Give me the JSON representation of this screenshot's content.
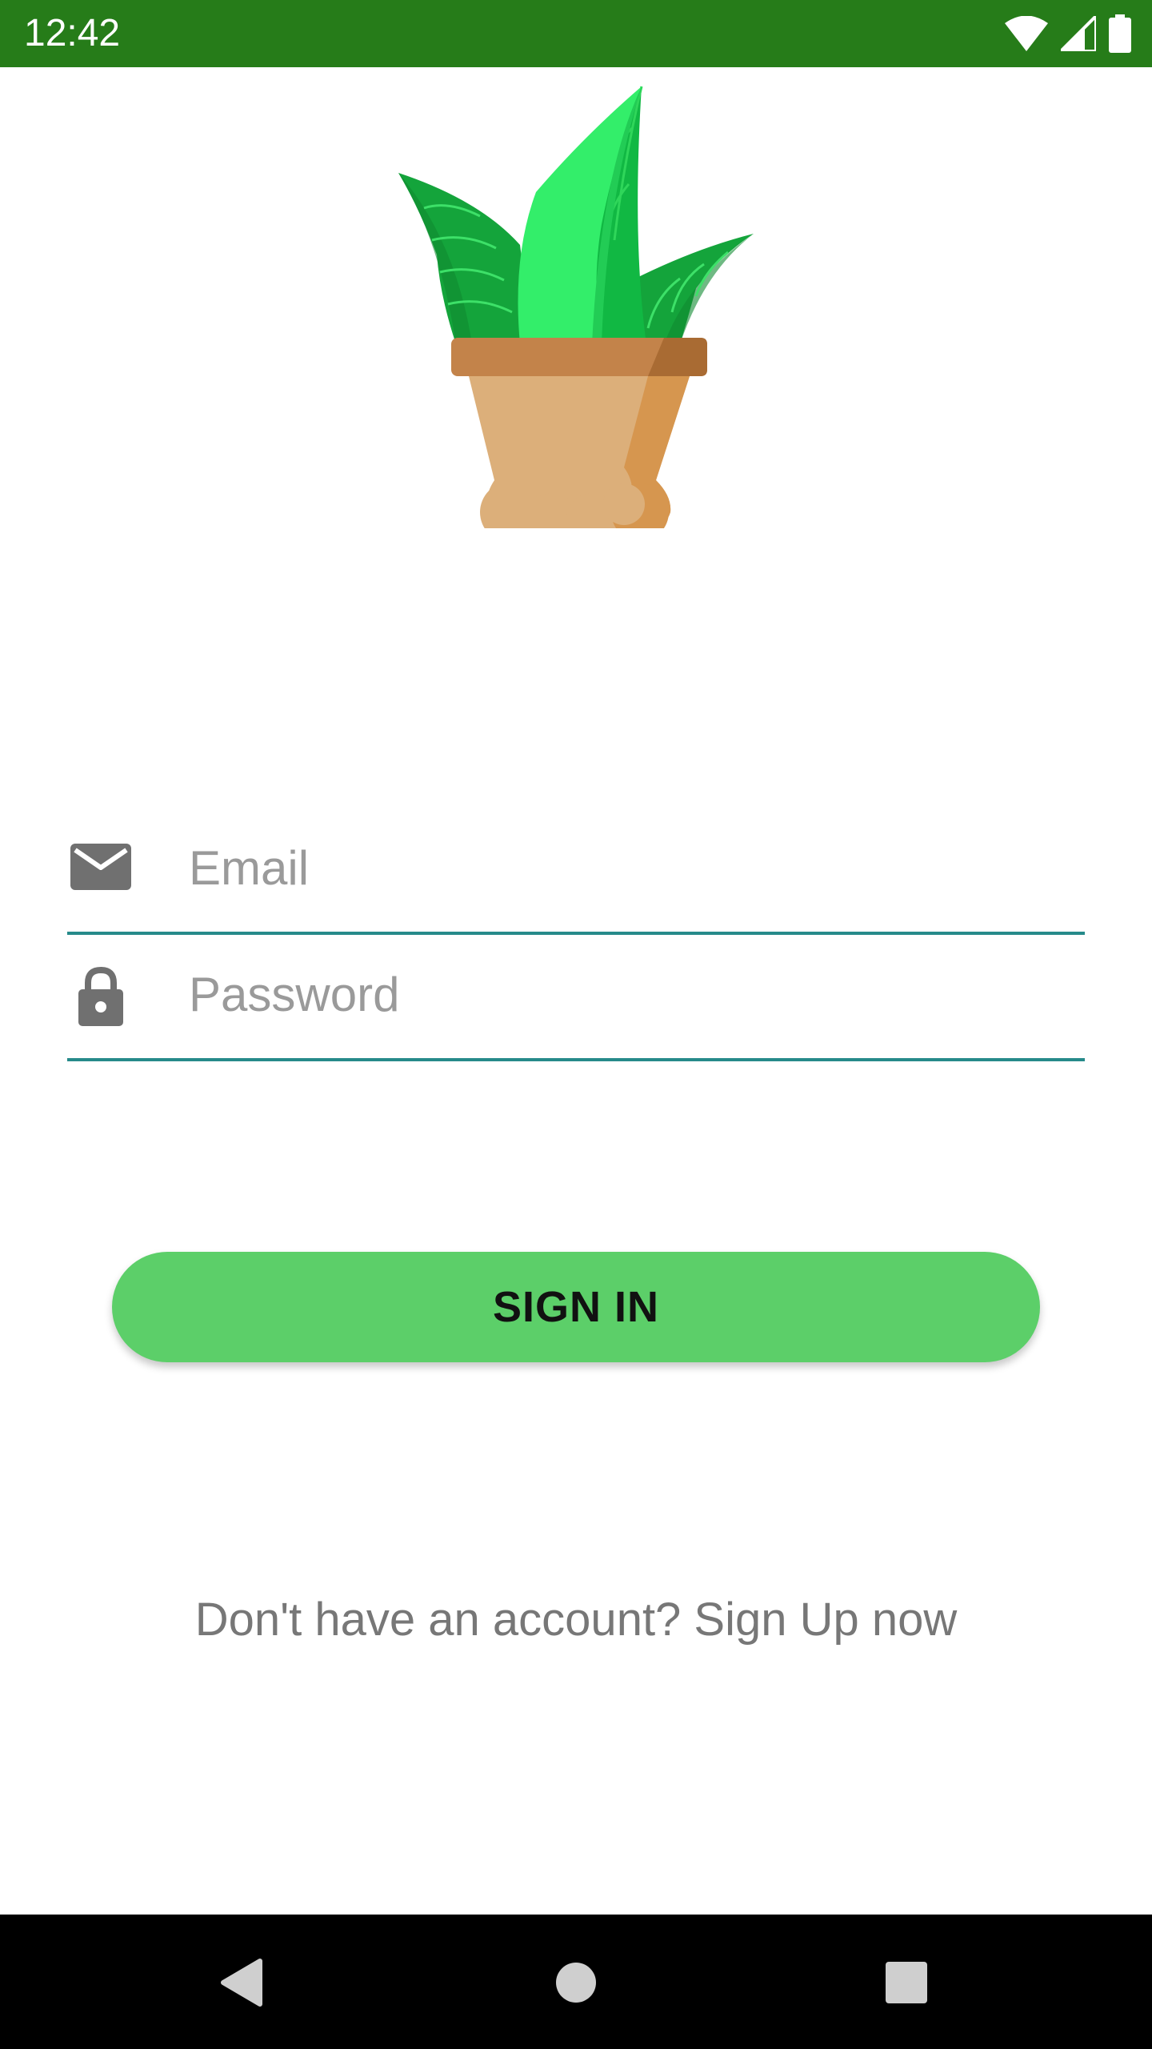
{
  "status_bar": {
    "time": "12:42",
    "background_color": "#267c19",
    "icons": [
      "wifi-icon",
      "cell-signal-icon",
      "battery-icon"
    ]
  },
  "logo": {
    "icon": "potted-plant-logo"
  },
  "form": {
    "email": {
      "placeholder": "Email",
      "value": "",
      "icon": "email-icon"
    },
    "password": {
      "placeholder": "Password",
      "value": "",
      "icon": "lock-icon"
    },
    "underline_color": "#268a8a"
  },
  "signin_button": {
    "label": "SIGN IN",
    "color": "#5ccf69"
  },
  "signup": {
    "text": "Don't have an account? Sign Up now"
  },
  "nav_bar": {
    "buttons": [
      "back-icon",
      "home-icon",
      "recents-icon"
    ]
  }
}
